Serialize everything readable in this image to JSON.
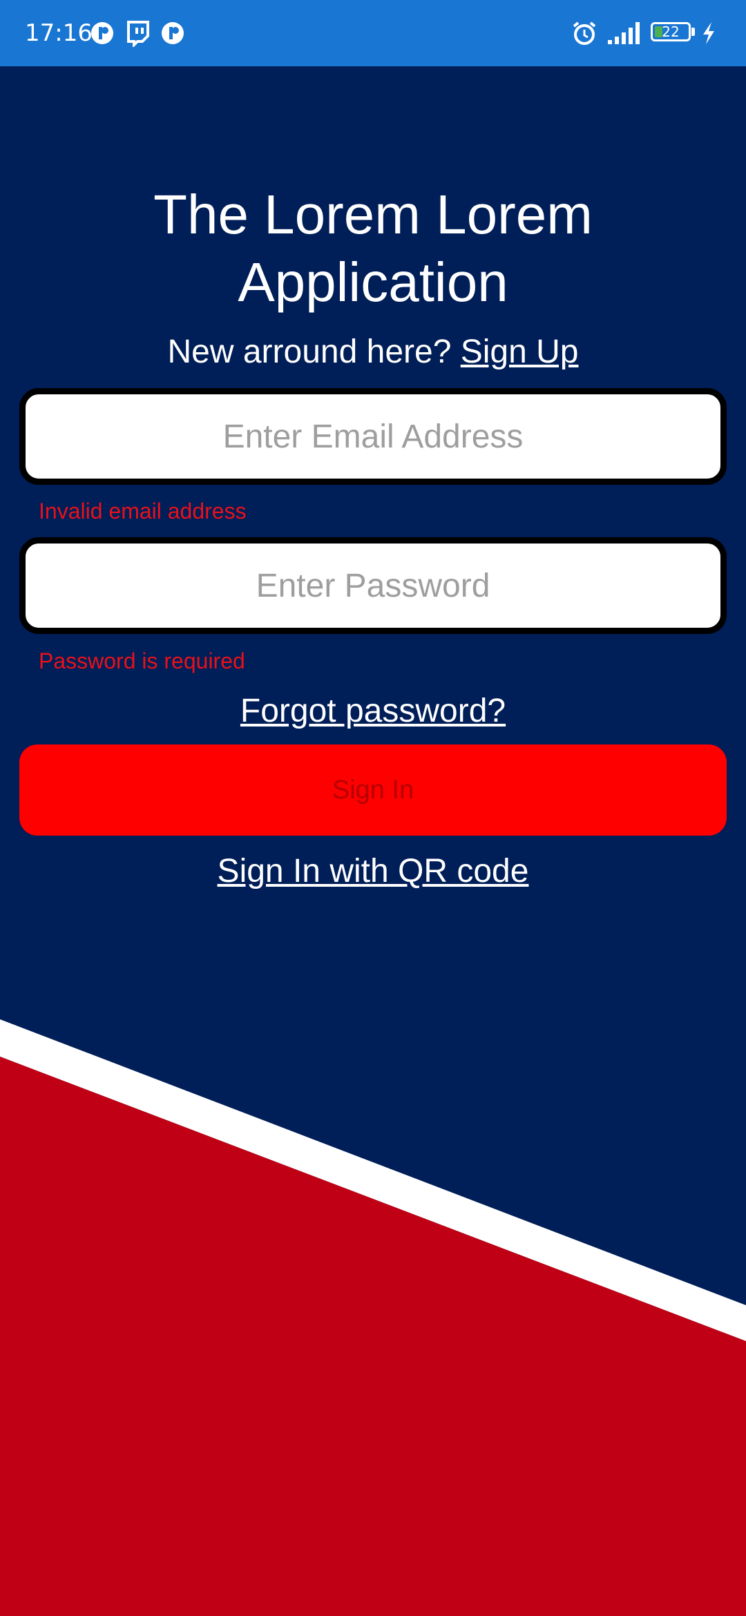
{
  "status_bar": {
    "time": "17:16",
    "left_icons": [
      "reddit-notification-icon",
      "twitch-notification-icon",
      "reddit-notification-icon"
    ],
    "right_icons": [
      "alarm-icon",
      "signal-icon",
      "battery-icon",
      "charging-icon"
    ],
    "battery_level": "22",
    "battery_fraction": 0.22,
    "background_color": "#1976D2"
  },
  "app": {
    "title_line1": "The Lorem Lorem",
    "title_line2": "Application",
    "signup_prompt": "New arround here?",
    "signup_link": "Sign Up"
  },
  "form": {
    "email_placeholder": "Enter Email Address",
    "email_value": "",
    "email_error": "Invalid email address",
    "password_placeholder": "Enter Password",
    "password_value": "",
    "password_error": "Password is required",
    "forgot_link": "Forgot password?",
    "signin_button": "Sign In",
    "qr_signin_link": "Sign In with QR code"
  },
  "colors": {
    "background_navy": "#001E57",
    "accent_red": "#C00014",
    "button_red": "#FF0000",
    "error_red": "#E8111B",
    "stripe_white": "#FFFFFF"
  }
}
